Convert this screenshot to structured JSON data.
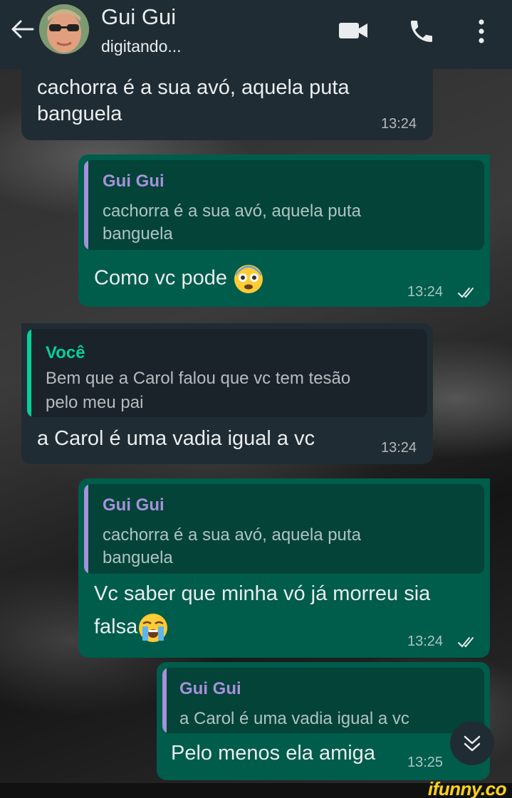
{
  "header": {
    "contact_name": "Gui Gui",
    "status": "digitando..."
  },
  "messages": [
    {
      "direction": "in",
      "text_line1": "cachorra é a sua avó, aquela puta",
      "text_line2": "banguela",
      "time": "13:24"
    },
    {
      "direction": "out",
      "quote_author": "Gui Gui",
      "quote_line1": "cachorra é a sua avó, aquela puta",
      "quote_line2": "banguela",
      "text": "Como vc pode",
      "emoji": "flushed-face-emoji",
      "time": "13:24",
      "read": true
    },
    {
      "direction": "in",
      "quote_author": "Você",
      "quote_line1": "Bem que a Carol falou que vc tem tesão",
      "quote_line2": "pelo meu pai",
      "text": "a Carol é uma vadia igual a vc",
      "time": "13:24"
    },
    {
      "direction": "out",
      "quote_author": "Gui Gui",
      "quote_line1": "cachorra é a sua avó, aquela puta",
      "quote_line2": "banguela",
      "text_line1": "Vc saber que minha vó já morreu sia",
      "text_line2": "falsa",
      "emoji": "crying-face-emoji",
      "time": "13:24",
      "read": true
    },
    {
      "direction": "out",
      "quote_author": "Gui Gui",
      "quote_line1": "a Carol é uma vadia igual a vc",
      "text": "Pelo menos ela amiga",
      "time": "13:25"
    }
  ],
  "watermark": "ifunny.co",
  "colors": {
    "header_bg": "#1f2c33",
    "incoming_bubble": "#202c33",
    "outgoing_bubble": "#005c4b",
    "quote_author_purple": "#a791db",
    "quote_author_green": "#06cf9c",
    "quote_bar_purple": "#a791db",
    "quote_bar_green": "#06cf9c",
    "read_ticks": "#e9edef"
  }
}
